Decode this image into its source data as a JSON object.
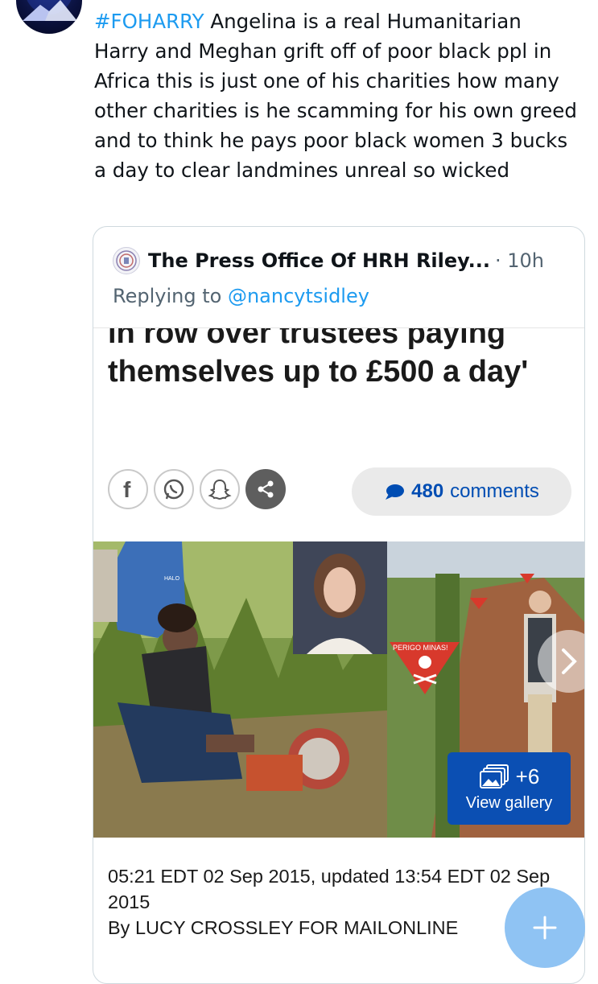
{
  "tweet": {
    "hashtag": "#FOHARRY",
    "text": " Angelina is a real Humanitarian Harry and Meghan grift off of poor black ppl in Africa this is just one of his charities how many other charities is he scamming for his own greed and to think he pays poor black women 3 bucks a day to clear landmines unreal so wicked"
  },
  "quote": {
    "author_name": "The Press Office Of HRH Riley...",
    "time": "· 10h",
    "replying_prefix": "Replying to",
    "replying_to": "@nancytsidley",
    "article": {
      "headline": "in row over trustees paying themselves up to £500 a day'",
      "comments_count": "480",
      "comments_label": "comments",
      "gallery_count": "+6",
      "gallery_label": "View gallery",
      "sign_text": "PERIGO MINAS!",
      "vest_text": "HALO",
      "dateline": "05:21 EDT 02 Sep 2015, updated 13:54 EDT 02 Sep 2015",
      "byline": "By LUCY CROSSLEY FOR MAILONLINE"
    }
  },
  "icons": [
    "avatar-logo",
    "seal-icon",
    "facebook-icon",
    "whatsapp-icon",
    "snapchat-icon",
    "share-icon",
    "comment-bubble-icon",
    "gallery-icon",
    "chevron-right-icon",
    "plus-icon"
  ],
  "colors": {
    "accent": "#1d9bf0",
    "mail_blue": "#004db3",
    "gallery_button": "#0b4fb3",
    "fab": "#8fc3f3"
  }
}
